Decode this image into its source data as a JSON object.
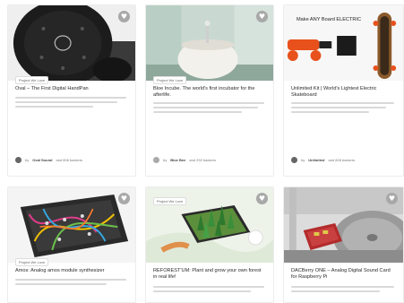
{
  "favorite_icon": "♥",
  "cards": [
    {
      "tag": "Project We Love",
      "title": "Oval – The First Digital HandPan",
      "creator_prefix": "by",
      "creator": "Oval Sound",
      "creator_suffix": "and 806 backers"
    },
    {
      "tag": "Project We Love",
      "title": "Bloe Incube. The world's first incubator for the afterlife.",
      "creator_prefix": "by",
      "creator": "Bloe Bee",
      "creator_suffix": "and 292 backers"
    },
    {
      "tag": "",
      "banner": "Make ANY Board ELECTRIC",
      "title": "Unlimited Kit | World's Lightest Electric Skateboard",
      "creator_prefix": "by",
      "creator": "Unlimited",
      "creator_suffix": "and 826 backers"
    },
    {
      "tag": "Project We Love",
      "title": "Amos: Analog amos module synthesizer"
    },
    {
      "tag": "Project We Love",
      "title": "REFOREST'UM: Plant and grow your own forest in real life!"
    },
    {
      "tag": "",
      "title": "DACBerry ONE – Analog Digital Sound Card for Raspberry Pi"
    }
  ]
}
